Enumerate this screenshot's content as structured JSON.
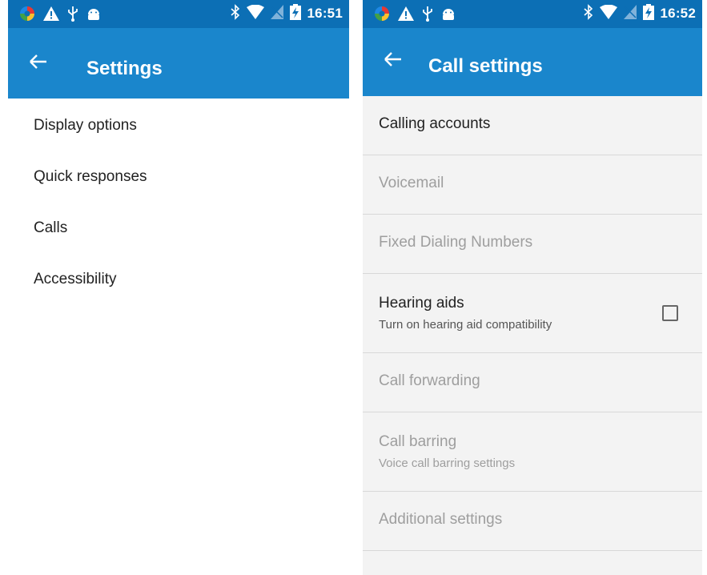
{
  "left": {
    "status": {
      "time": "16:51"
    },
    "appbar": {
      "title": "Settings"
    },
    "items": [
      {
        "label": "Display options"
      },
      {
        "label": "Quick responses"
      },
      {
        "label": "Calls"
      },
      {
        "label": "Accessibility"
      }
    ]
  },
  "right": {
    "status": {
      "time": "16:52"
    },
    "appbar": {
      "title": "Call settings"
    },
    "items": [
      {
        "title": "Calling accounts",
        "enabled": true
      },
      {
        "title": "Voicemail",
        "enabled": false
      },
      {
        "title": "Fixed Dialing Numbers",
        "enabled": false
      },
      {
        "title": "Hearing aids",
        "subtitle": "Turn on hearing aid compatibility",
        "enabled": true,
        "checked": false
      },
      {
        "title": "Call forwarding",
        "enabled": false
      },
      {
        "title": "Call barring",
        "subtitle": "Voice call barring settings",
        "enabled": false
      },
      {
        "title": "Additional settings",
        "enabled": false
      }
    ]
  },
  "colors": {
    "status_bar": "#0c6fb5",
    "app_bar": "#1a86cc"
  },
  "status_icons": [
    "colorful-app-icon",
    "warning-icon",
    "usb-icon",
    "android-icon",
    "bluetooth-icon",
    "wifi-icon",
    "no-sim-icon",
    "battery-charging-icon"
  ]
}
